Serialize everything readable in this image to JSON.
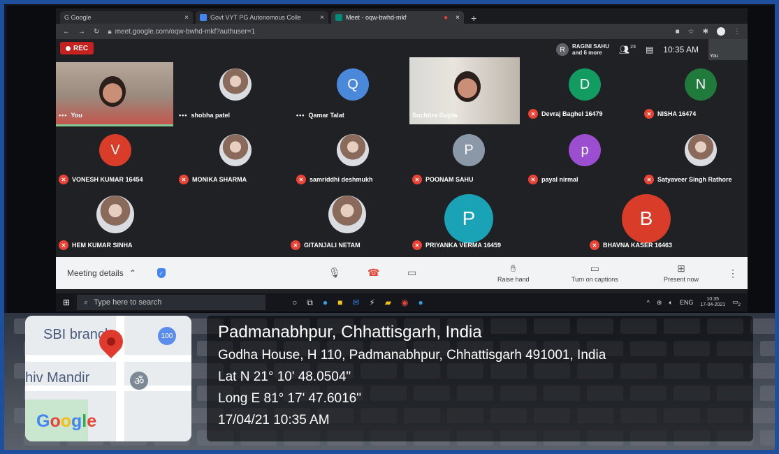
{
  "browser": {
    "tabs": [
      {
        "label": "G  Google",
        "active": false
      },
      {
        "label": "Govt VYT PG Autonomous Colle",
        "active": false
      },
      {
        "label": "Meet - oqw-bwhd-mkf",
        "active": true
      }
    ],
    "url": "meet.google.com/oqw-bwhd-mkf?authuser=1"
  },
  "meet": {
    "rec_label": "REC",
    "presenter": {
      "initial": "R",
      "name": "RAGINI SAHU",
      "sub": "and 6 more"
    },
    "participant_count": "23",
    "time": "10:35 AM",
    "you_thumb": "You",
    "participants": [
      {
        "name": "You",
        "kind": "video-you",
        "muted": false,
        "more": true
      },
      {
        "name": "shobha patel",
        "kind": "photo",
        "muted": false,
        "more": true
      },
      {
        "name": "Qamar Talat",
        "initial": "Q",
        "color": "#4a88d9",
        "muted": false,
        "more": true
      },
      {
        "name": "Suchitra Gupta",
        "kind": "video-suchitra",
        "muted": false
      },
      {
        "name": "Devraj Baghel 16479",
        "initial": "D",
        "color": "#129c62",
        "muted": true
      },
      {
        "name": "NISHA 16474",
        "initial": "N",
        "color": "#1f7a3b",
        "muted": true
      },
      {
        "name": "VONESH KUMAR 16454",
        "initial": "V",
        "color": "#d93d2a",
        "muted": true
      },
      {
        "name": "MONIKA SHARMA",
        "kind": "photo",
        "muted": true
      },
      {
        "name": "samriddhi deshmukh",
        "kind": "photo",
        "muted": true
      },
      {
        "name": "POONAM SAHU",
        "initial": "P",
        "color": "#8a98a8",
        "muted": true
      },
      {
        "name": "payal nirmal",
        "initial": "p",
        "color": "#9b4fd0",
        "muted": true
      },
      {
        "name": "Satyaveer Singh Rathore",
        "kind": "photo",
        "muted": true
      },
      {
        "name": "HEM KUMAR SINHA",
        "kind": "photo",
        "muted": true
      },
      {
        "name": "GITANJALI NETAM",
        "kind": "photo",
        "muted": true
      },
      {
        "name": "PRIYANKA VERMA 16459",
        "initial": "P",
        "color": "#1aa3b7",
        "muted": true
      },
      {
        "name": "BHAVNA KASER 16463",
        "initial": "B",
        "color": "#d93d2a",
        "muted": true
      }
    ],
    "bottom_bar": {
      "details": "Meeting details",
      "raise_hand": "Raise hand",
      "captions": "Turn on captions",
      "present": "Present now"
    }
  },
  "taskbar": {
    "search_placeholder": "Type here to search",
    "lang": "ENG",
    "time": "10:35",
    "date": "17-04-2021",
    "notif_count": "2"
  },
  "gps": {
    "title": "Padmanabhpur, Chhattisgarh, India",
    "address": "Godha House, H 110, Padmanabhpur, Chhattisgarh 491001, India",
    "lat": "Lat N 21° 10' 48.0504\"",
    "long": "Long E 81° 17' 47.6016\"",
    "datetime": "17/04/21 10:35 AM",
    "map_labels": [
      "SBI branch",
      "hiv Mandir"
    ],
    "map_badge_100": "100",
    "map_badge_om": "ॐ",
    "google_letters": [
      "G",
      "o",
      "o",
      "g",
      "l",
      "e"
    ],
    "google_colors": [
      "#4285f4",
      "#ea4335",
      "#fbbc05",
      "#4285f4",
      "#34a853",
      "#ea4335"
    ]
  }
}
